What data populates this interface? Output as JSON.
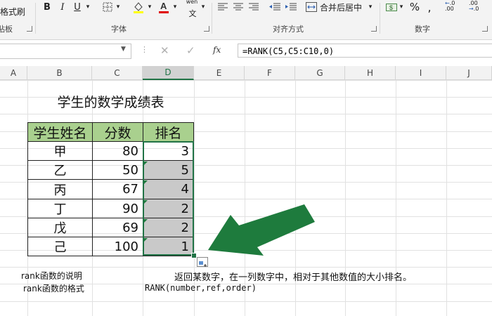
{
  "ribbon": {
    "format_painter_label": "格式刷",
    "bold": "B",
    "italic": "I",
    "underline": "U",
    "group_font_label": "字体",
    "group_align_label": "对齐方式",
    "group_number_label": "数字",
    "clipboard_label_fragment": "贴板",
    "merge_center_label": "合并后居中",
    "phonetic_label": "wén",
    "phonetic_glyph": "文",
    "currency_symbol": "$",
    "percent_symbol": "%",
    "comma_symbol": ",",
    "inc_decimal_label": ".00",
    "dec_decimal_label": ".0"
  },
  "formula_bar": {
    "fx_label": "fx",
    "formula": "=RANK(C5,C5:C10,0)"
  },
  "columns": [
    "A",
    "B",
    "C",
    "D",
    "E",
    "F",
    "G",
    "H",
    "I",
    "J"
  ],
  "sheet": {
    "title": "学生的数学成绩表",
    "headers": [
      "学生姓名",
      "分数",
      "排名"
    ],
    "rows": [
      {
        "name": "甲",
        "score": "80",
        "rank": "3"
      },
      {
        "name": "乙",
        "score": "50",
        "rank": "5"
      },
      {
        "name": "丙",
        "score": "67",
        "rank": "4"
      },
      {
        "name": "丁",
        "score": "90",
        "rank": "2"
      },
      {
        "name": "戊",
        "score": "69",
        "rank": "2"
      },
      {
        "name": "己",
        "score": "100",
        "rank": "1"
      }
    ],
    "note1_label": "rank函数的说明",
    "note1_text": "返回某数字，在一列数字中，相对于其他数值的大小排名。",
    "note2_label": "rank函数的格式",
    "note2_text": "RANK(number,ref,order)"
  },
  "colors": {
    "header_fill": "#a9d08e",
    "selection_fill": "#c9c9c9",
    "selection_border": "#217346",
    "arrow": "#1e7b3d"
  }
}
